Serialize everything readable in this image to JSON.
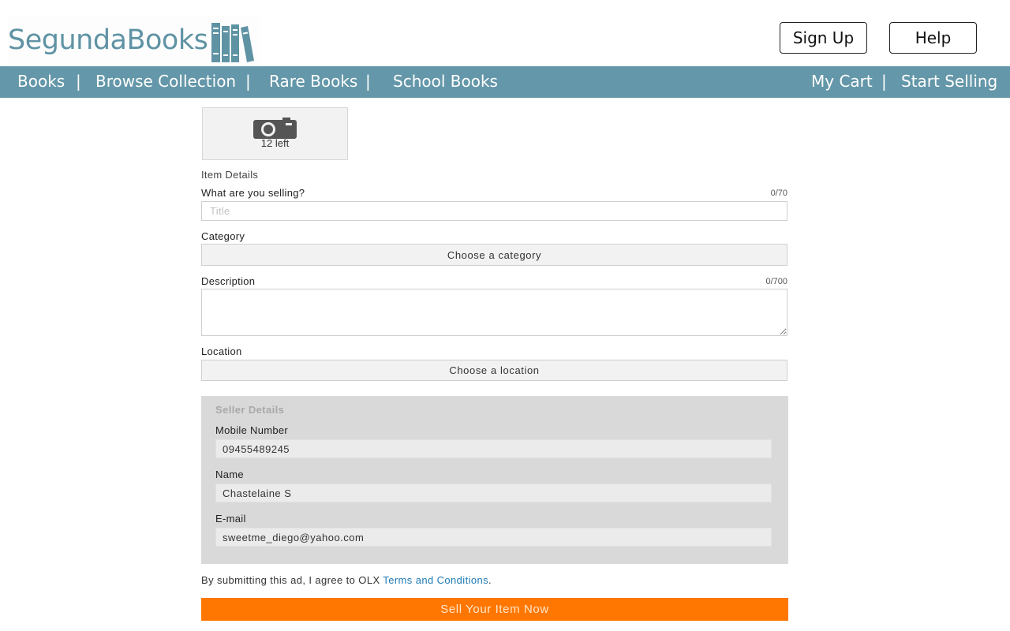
{
  "header": {
    "logo_text": "SegundaBooks",
    "signup_label": "Sign Up",
    "help_label": "Help"
  },
  "nav": {
    "books": "Books",
    "browse": "Browse Collection",
    "rare": "Rare Books",
    "school": "School Books",
    "cart": "My Cart",
    "start_selling": "Start Selling",
    "separator": "|"
  },
  "photo": {
    "icon": "camera-icon",
    "remaining": "12 left"
  },
  "item_details": {
    "heading": "Item Details",
    "title_label": "What are you selling?",
    "title_counter": "0/70",
    "title_placeholder": "Title",
    "category_label": "Category",
    "category_button": "Choose a category",
    "description_label": "Description",
    "description_counter": "0/700",
    "location_label": "Location",
    "location_button": "Choose a location"
  },
  "seller_details": {
    "heading": "Seller Details",
    "mobile_label": "Mobile Number",
    "mobile_value": "09455489245",
    "name_label": "Name",
    "name_value": "Chastelaine S",
    "email_label": "E-mail",
    "email_value": "sweetme_diego@yahoo.com"
  },
  "terms": {
    "text": "By submitting this ad, I agree to OLX ",
    "link": "Terms and Conditions",
    "end": "."
  },
  "submit_label": "Sell Your Item Now",
  "colors": {
    "nav_bg": "#6497a9",
    "logo": "#5f93a4",
    "submit": "#ff7700",
    "link": "#1f7bb6"
  }
}
